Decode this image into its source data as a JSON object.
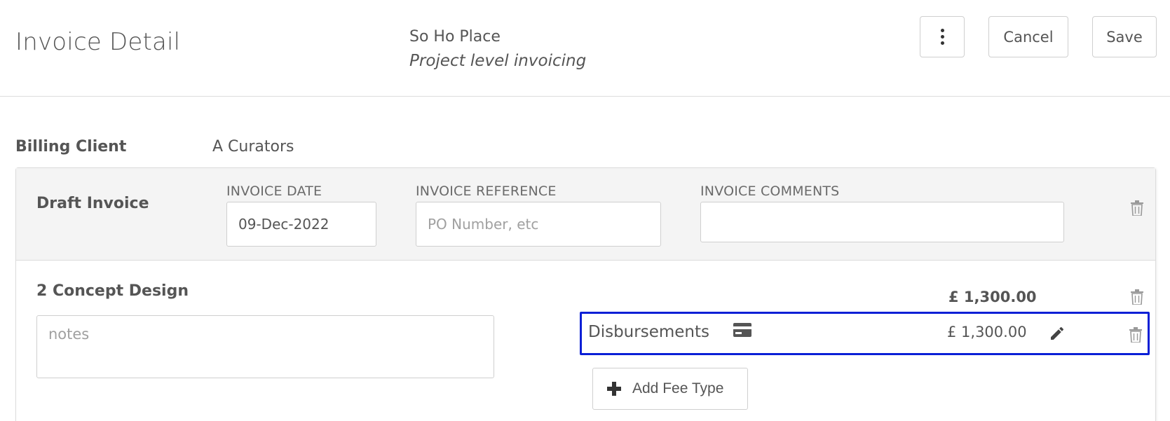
{
  "header": {
    "title": "Invoice Detail",
    "project_name": "So Ho Place",
    "project_mode": "Project level invoicing",
    "more_icon": "kebab-vertical-icon",
    "cancel_label": "Cancel",
    "save_label": "Save"
  },
  "billing": {
    "label": "Billing Client",
    "value": "A Curators"
  },
  "invoice": {
    "title": "Draft Invoice",
    "date_label": "INVOICE DATE",
    "date_value": "09-Dec-2022",
    "reference_label": "INVOICE REFERENCE",
    "reference_placeholder": "PO Number, etc",
    "comments_label": "INVOICE COMMENTS",
    "comments_value": "",
    "delete_icon": "trash-icon"
  },
  "line_item": {
    "title": "2 Concept Design",
    "notes_placeholder": "notes",
    "total": "£ 1,300.00",
    "delete_icon": "trash-icon",
    "fees": [
      {
        "name": "Disbursements",
        "icon": "credit-card-icon",
        "amount": "£ 1,300.00",
        "edit_icon": "pencil-icon",
        "delete_icon": "trash-icon"
      }
    ],
    "add_fee_label": "Add Fee Type"
  },
  "colors": {
    "highlight_border": "#0a1fd6",
    "panel_bg": "#f4f4f4",
    "text": "#555555"
  }
}
